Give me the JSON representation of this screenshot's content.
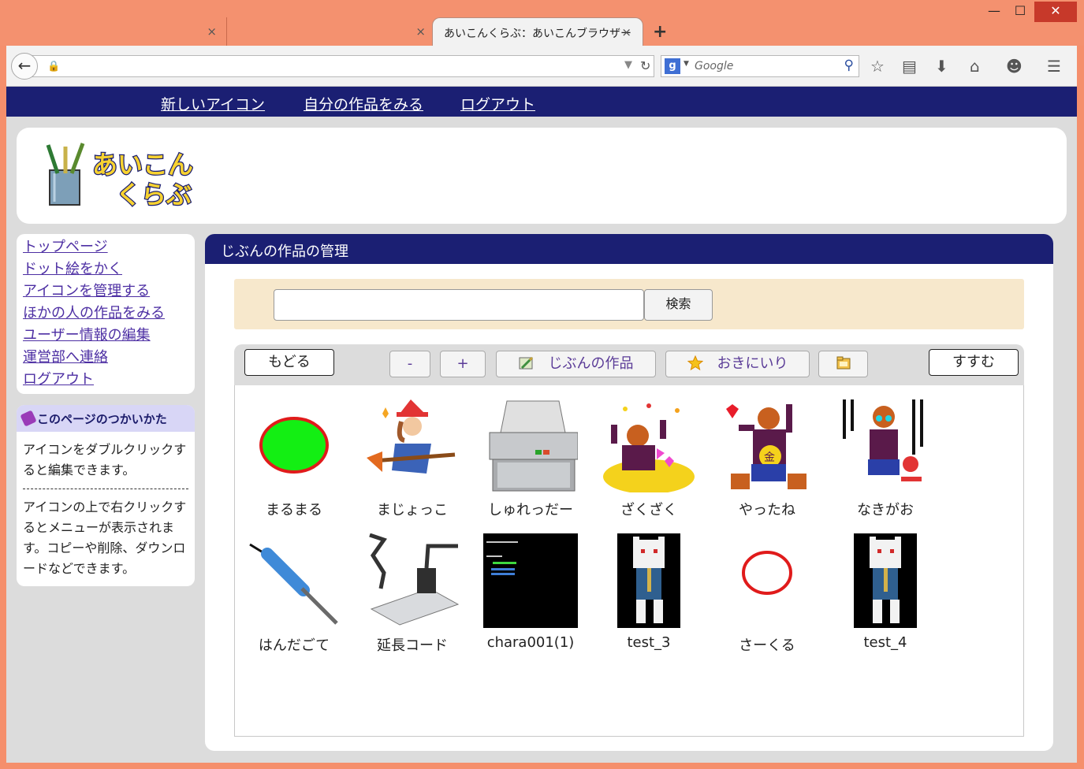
{
  "browser": {
    "tabs": [
      {
        "label": ""
      },
      {
        "label": ""
      },
      {
        "label": "あいこんくらぶ：あいこんブラウザー"
      }
    ],
    "tab_close_glyph": "×",
    "new_tab_glyph": "+",
    "window_buttons": {
      "minimize": "—",
      "maximize": "☐",
      "close": "✕"
    },
    "url": "",
    "search_placeholder": "Google"
  },
  "site": {
    "nav": [
      "新しいアイコン",
      "自分の作品をみる",
      "ログアウト"
    ],
    "logo_text": "あいこん くらぶ",
    "sidebar_links": [
      "トップページ",
      "ドット絵をかく",
      "アイコンを管理する",
      "ほかの人の作品をみる",
      "ユーザー情報の編集",
      "運営部へ連絡",
      "ログアウト"
    ],
    "help": {
      "title": "このページのつかいかた",
      "tip1": "アイコンをダブルクリックすると編集できます。",
      "tip2": "アイコンの上で右クリックするとメニューが表示されます。コピーや削除、ダウンロードなどできます。"
    }
  },
  "main": {
    "title": "じぶんの作品の管理",
    "search_value": "",
    "search_button": "検索",
    "toolbar": {
      "back": "もどる",
      "minus": "-",
      "plus": "+",
      "my_works": "じぶんの作品",
      "favorites": "おきにいり",
      "forward": "すすむ"
    },
    "icons": [
      "まるまる",
      "まじょっこ",
      "しゅれっだー",
      "ざくざく",
      "やったね",
      "なきがお",
      "はんだごて",
      "延長コード",
      "chara001(1)",
      "test_3",
      "さーくる",
      "test_4"
    ]
  },
  "colors": {
    "brand_navy": "#1b1f73",
    "link_purple": "#4d2fa3",
    "search_panel": "#f7e8cc",
    "browser_frame": "#f4916f"
  }
}
